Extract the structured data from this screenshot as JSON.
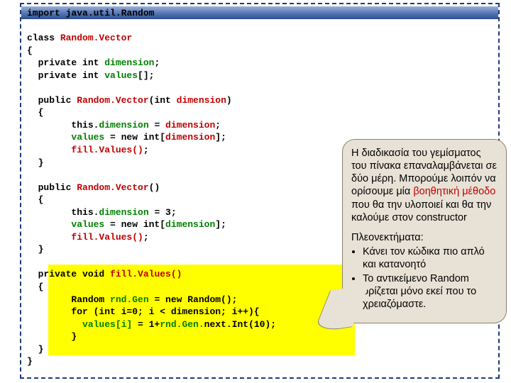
{
  "code": {
    "l1a": "import",
    "l1b": " java.util.Random",
    "l2": "",
    "l3a": "class ",
    "l3b": "Random.Vector",
    "l4": "{",
    "l5a": "  private int ",
    "l5b": "dimension",
    "l5c": ";",
    "l6a": "  private int ",
    "l6b": "values",
    "l6c": "[];",
    "l7": "",
    "l8a": "  public ",
    "l8b": "Random.Vector",
    "l8c": "(int ",
    "l8d": "dimension",
    "l8e": ")",
    "l9": "  {",
    "l10a": "        this.",
    "l10b": "dimension",
    "l10c": " = ",
    "l10d": "dimension",
    "l10e": ";",
    "l11a": "        values",
    "l11b": " = new int[",
    "l11c": "dimension",
    "l11d": "];",
    "l12a": "        ",
    "l12b": "fill.Values()",
    "l12c": ";",
    "l13": "  }",
    "l14": "",
    "l15a": "  public ",
    "l15b": "Random.Vector",
    "l15c": "()",
    "l16": "  {",
    "l17a": "        this.",
    "l17b": "dimension",
    "l17c": " = 3;",
    "l18a": "        values",
    "l18b": " = new int[",
    "l18c": "dimension",
    "l18d": "];",
    "l19a": "        ",
    "l19b": "fill.Values()",
    "l19c": ";",
    "l20": "  }",
    "l21": "",
    "l22a": "  private void ",
    "l22b": "fill.Values()",
    "l23": "  {",
    "l24a": "        Random ",
    "l24b": "rnd.Gen",
    "l24c": " = new Random();",
    "l25": "        for (int i=0; i < dimension; i++){",
    "l26a": "          values[i] ",
    "l26b": "= 1+",
    "l26c": "rnd.Gen.",
    "l26d": "next.Int(10);",
    "l27": "        }",
    "l28": "  }",
    "l29": "}"
  },
  "callout": {
    "p1a": "Η διαδικασία του γεμίσματος του πίνακα επαναλαμβάνεται σε δύο μέρη. Μπορούμε λοιπόν να ορίσουμε μία ",
    "p1b": "βοηθητική μέθοδο",
    "p1c": " που θα την υλοποιεί και θα την καλούμε στον constructor",
    "p2": "Πλεονεκτήματα:",
    "li1": "Κάνει τον κώδικα πιο απλό και κατανοητό",
    "li2": "Το αντικείμενο Random ορίζεται μόνο εκεί που το χρειαζόμαστε."
  }
}
